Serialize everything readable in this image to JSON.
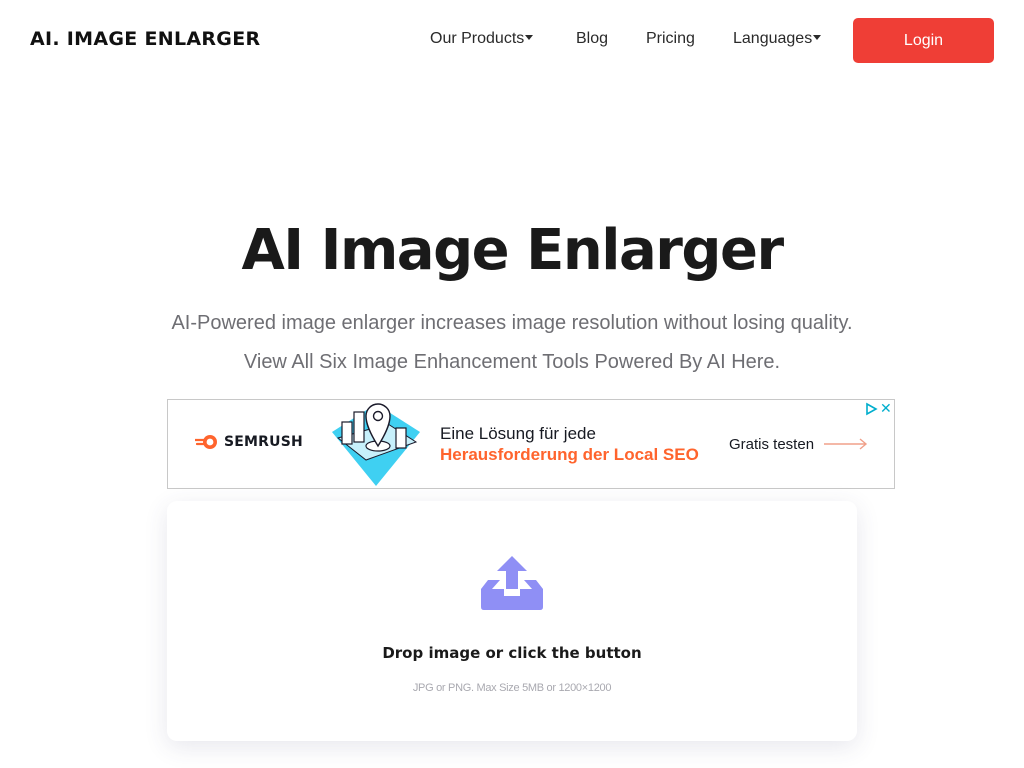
{
  "header": {
    "logo": "AI. IMAGE ENLARGER",
    "nav": [
      {
        "label": "Our Products",
        "dropdown": true
      },
      {
        "label": "Blog",
        "dropdown": false
      },
      {
        "label": "Pricing",
        "dropdown": false
      },
      {
        "label": "Languages",
        "dropdown": true
      }
    ],
    "login_label": "Login",
    "accent_color": "#ef3e36"
  },
  "hero": {
    "title": "AI Image Enlarger",
    "subtitle_line1": "AI-Powered image enlarger increases image resolution without losing quality.",
    "subtitle_line2": "View All Six Image Enhancement Tools Powered By AI Here."
  },
  "ad": {
    "brand": "SEMRUSH",
    "headline": "Eine Lösung für jede",
    "headline_highlight": "Herausforderung der Local SEO",
    "cta": "Gratis testen",
    "highlight_color": "#ff642d",
    "icons": [
      "adchoices-icon",
      "close-icon"
    ],
    "close_glyph": "✕"
  },
  "upload": {
    "icon": "upload-icon",
    "title": "Drop image or click the button",
    "hint": "JPG or PNG. Max Size 5MB or 1200×1200",
    "icon_color": "#8f8ff5"
  }
}
